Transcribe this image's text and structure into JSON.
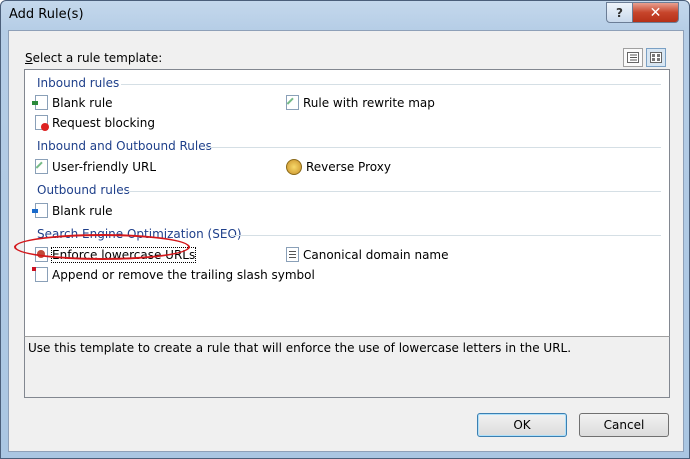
{
  "window": {
    "title": "Add Rule(s)",
    "help_glyph": "?",
    "close_glyph": "✕"
  },
  "dialog": {
    "prompt_access_key": "S",
    "prompt_rest": "elect a rule template:",
    "view_icons": [
      "list-view-icon",
      "tile-view-icon"
    ]
  },
  "groups": [
    {
      "header": "Inbound rules",
      "items": [
        {
          "label": "Blank rule",
          "icon": "blank-rule-icon"
        },
        {
          "label": "Rule with rewrite map",
          "icon": "rewrite-map-icon"
        },
        {
          "label": "Request blocking",
          "icon": "request-blocking-icon"
        }
      ]
    },
    {
      "header": "Inbound and Outbound Rules",
      "items": [
        {
          "label": "User-friendly URL",
          "icon": "user-friendly-url-icon"
        },
        {
          "label": "Reverse Proxy",
          "icon": "reverse-proxy-icon"
        }
      ]
    },
    {
      "header": "Outbound rules",
      "items": [
        {
          "label": "Blank rule",
          "icon": "outbound-blank-rule-icon"
        }
      ]
    },
    {
      "header": "Search Engine Optimization (SEO)",
      "items": [
        {
          "label": "Enforce lowercase URLs",
          "icon": "lowercase-url-icon",
          "selected": true
        },
        {
          "label": "Canonical domain name",
          "icon": "canonical-domain-icon"
        },
        {
          "label": "Append or remove the trailing slash symbol",
          "icon": "trailing-slash-icon"
        }
      ]
    }
  ],
  "description": "Use this template to create a rule that will enforce the use of lowercase letters in the URL.",
  "buttons": {
    "ok": "OK",
    "cancel": "Cancel"
  },
  "colors": {
    "group_header": "#1e3f8a",
    "annotation_ring": "#d3171b"
  }
}
